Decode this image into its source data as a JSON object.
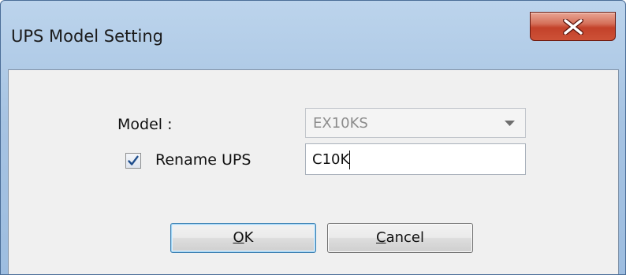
{
  "window": {
    "title": "UPS Model Setting",
    "close_icon": "close-icon"
  },
  "form": {
    "model_label": "Model :",
    "model_value": "EX10KS",
    "rename_checked": true,
    "rename_label": "Rename UPS",
    "rename_value": "C10K"
  },
  "buttons": {
    "ok_accel": "O",
    "ok_rest": "K",
    "cancel_accel": "C",
    "cancel_rest": "ancel"
  },
  "colors": {
    "close_button": "#c3422a",
    "client_background": "#f0f0f0",
    "titlebar": "#a6c3e2"
  }
}
